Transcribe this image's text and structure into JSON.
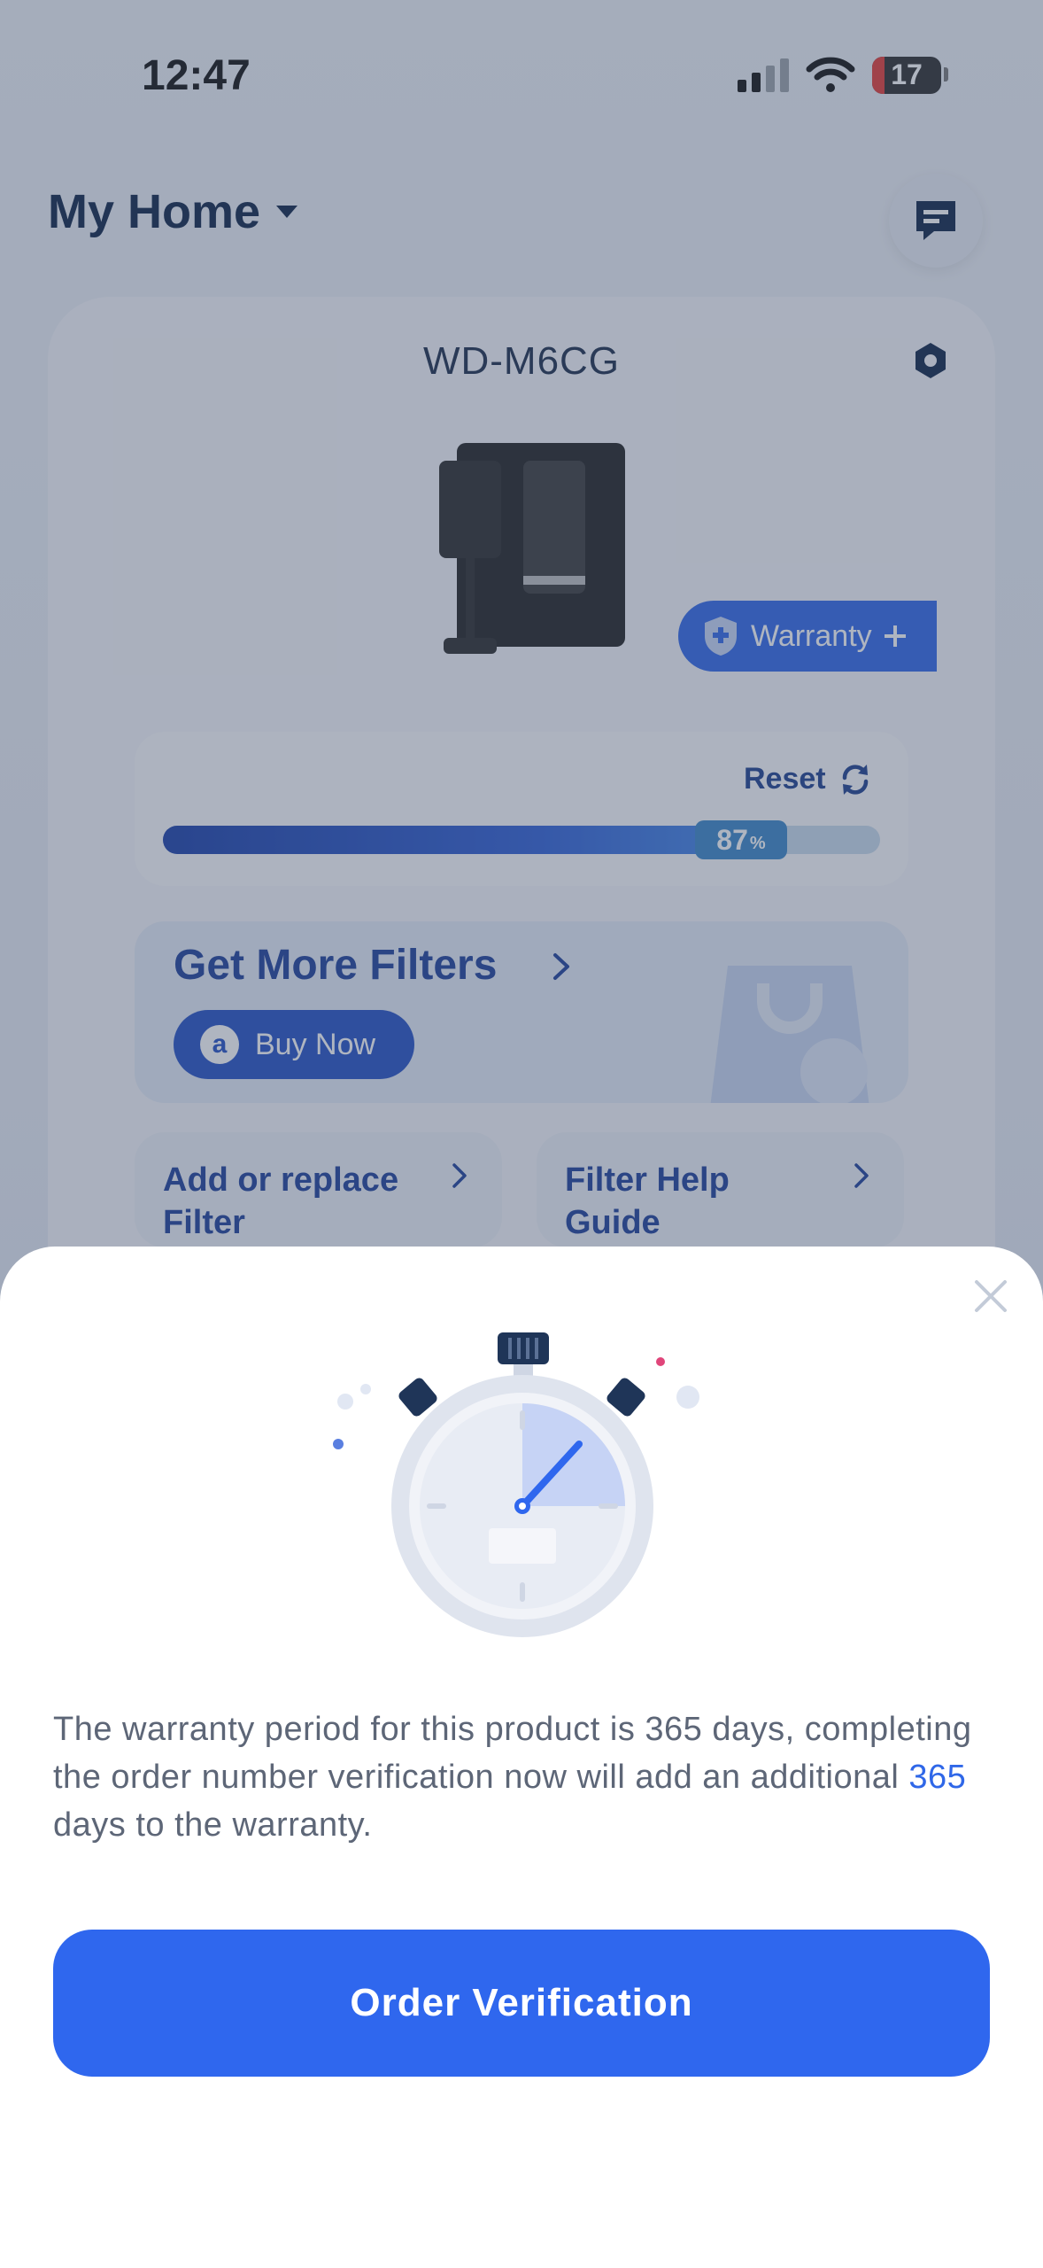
{
  "status_bar": {
    "time": "12:47",
    "battery": "17"
  },
  "header": {
    "title": "My Home",
    "message_icon": "message-icon"
  },
  "device": {
    "name": "WD-M6CG",
    "warranty_label": "Warranty",
    "reset_label": "Reset",
    "filter_percent": 87,
    "filter_percent_text": "87",
    "percent_sign": "%"
  },
  "get_filters": {
    "title": "Get More Filters",
    "buy_label": "Buy Now"
  },
  "cards": [
    {
      "label": "Add or replace Filter"
    },
    {
      "label": "Filter Help Guide"
    }
  ],
  "sheet": {
    "message_part1": "The warranty period for this product is 365 days, completing the order number verification now will add an additional ",
    "message_highlight": "365",
    "message_part2": " days to the warranty.",
    "button_label": "Order Verification"
  },
  "colors": {
    "accent": "#2f67ee",
    "heading": "#0d2348",
    "body_text": "#5d6677"
  }
}
